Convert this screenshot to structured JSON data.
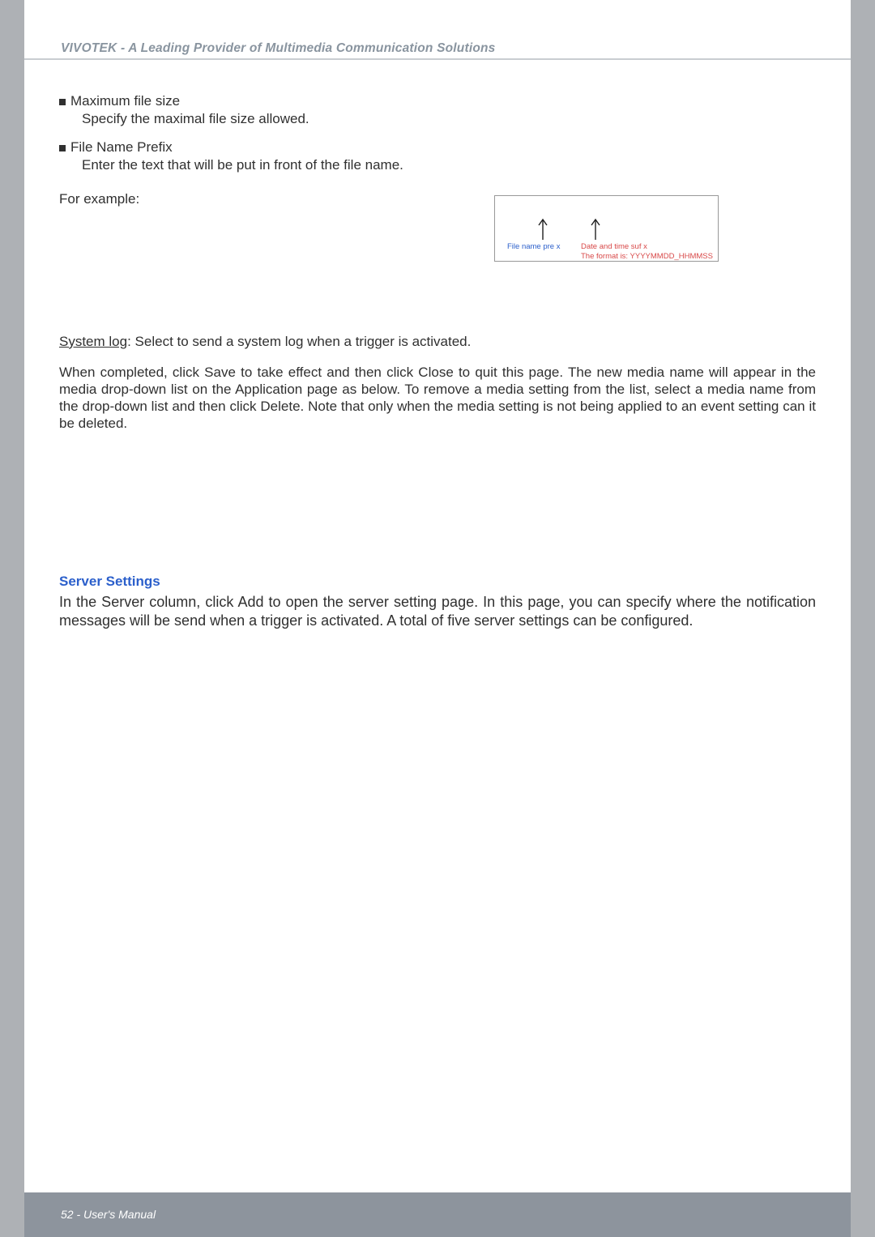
{
  "header": {
    "title": "VIVOTEK - A Leading Provider of Multimedia Communication Solutions"
  },
  "bullets": {
    "max_file_size_title": "Maximum file size",
    "max_file_size_desc": "Specify the maximal file size allowed.",
    "file_name_prefix_title": "File Name Prefix",
    "file_name_prefix_desc": "Enter the text that will be put in front of the file name."
  },
  "for_example": "For example:",
  "diagram": {
    "left_label": "File name pre x",
    "right_label_1": "Date and time suf x",
    "right_label_2": "The format is: YYYYMMDD_HHMMSS"
  },
  "system_log": {
    "label": "System log",
    "desc": ": Select to send a system log when a trigger is activated."
  },
  "media_paragraph": "When completed, click Save to take effect and then click Close to quit this page. The new media name will appear in the media drop-down list on the Application page as below. To remove a media setting from the list, select a media name from the drop-down list and then click Delete. Note that only when the media setting is not being applied to an event setting can it be deleted.",
  "server_settings": {
    "title": "Server Settings",
    "desc": "In the Server column, click Add to open the server setting page. In this page, you can specify where the notification messages will be send when a trigger is activated. A total of five server settings can be configured."
  },
  "footer": {
    "page_num": "52",
    "label": " - User's Manual"
  }
}
